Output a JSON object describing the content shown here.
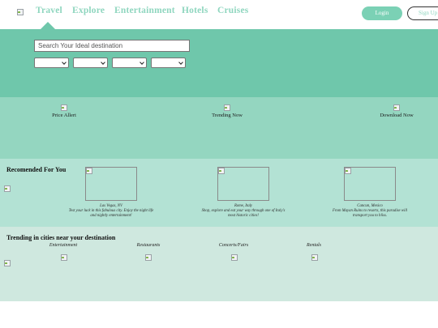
{
  "header": {
    "nav": [
      {
        "label": "Travel"
      },
      {
        "label": "Explore"
      },
      {
        "label": "Entertainment"
      },
      {
        "label": "Hotels"
      },
      {
        "label": "Cruises"
      }
    ],
    "login_label": "Login",
    "signup_label": "Sign Up"
  },
  "search": {
    "placeholder": "Search Your Ideal destination",
    "value": ""
  },
  "features": [
    {
      "label": "Price Allert"
    },
    {
      "label": "Trending Now"
    },
    {
      "label": "Download Now"
    }
  ],
  "recommended": {
    "title": "Recomended For You",
    "cards": [
      {
        "place": "Las Vegas, NV",
        "text": "Test your luck in this fabulous city. Enjoy the night life and nightly entertainment!"
      },
      {
        "place": "Rome, Italy",
        "text": "Shop, explore and eat your way through one of Italy's most historic cities!"
      },
      {
        "place": "Cancun, Mexico",
        "text": "From Mayan Ruins to resorts, this paradise will transport you to bliss."
      }
    ]
  },
  "trending": {
    "title": "Trending in cities near your destination",
    "categories": [
      {
        "label": "Entertainment"
      },
      {
        "label": "Restaurants"
      },
      {
        "label": "Concerts/Fairs"
      },
      {
        "label": "Rentals"
      }
    ]
  },
  "colors": {
    "accent": "#6fc7ab",
    "nav_text": "#8fd6bf",
    "feature_band": "#94d6c0",
    "recommended_band": "#b3e2d4",
    "trending_band": "#cfe8df"
  }
}
